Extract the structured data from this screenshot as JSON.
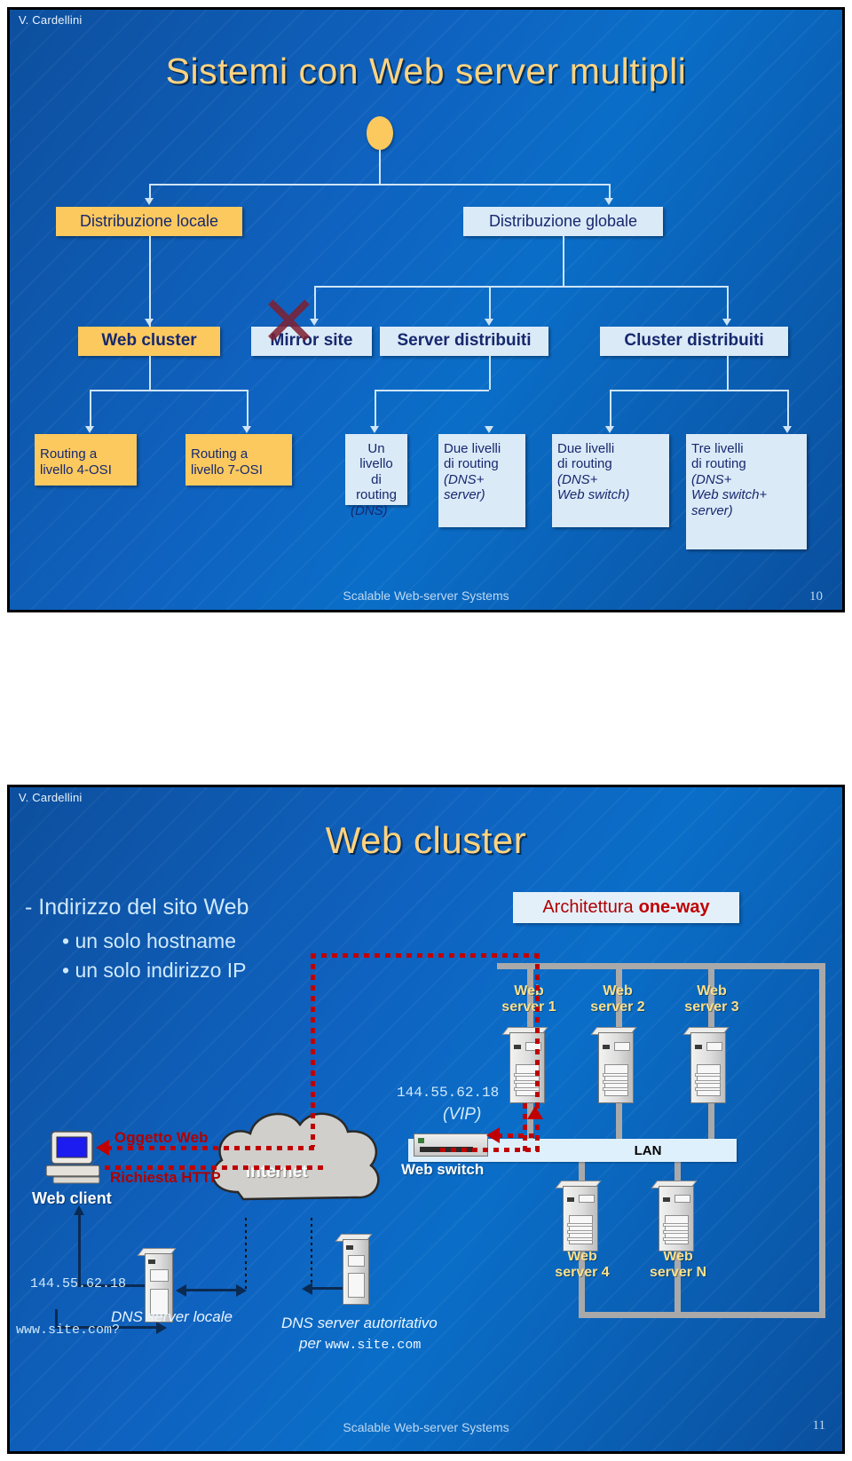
{
  "slide1": {
    "author": "V. Cardellini",
    "title": "Sistemi con Web server multipli",
    "footer": "Scalable Web-server Systems",
    "page": "10",
    "tree": {
      "level1": [
        {
          "label": "Distribuzione locale",
          "style": "gold"
        },
        {
          "label": "Distribuzione globale",
          "style": "light"
        }
      ],
      "level2": [
        {
          "label": "Web cluster",
          "style": "gold"
        },
        {
          "label": "Mirror site",
          "style": "light",
          "crossed": true
        },
        {
          "label": "Server distribuiti",
          "style": "light"
        },
        {
          "label": "Cluster distribuiti",
          "style": "light"
        }
      ],
      "level3": [
        {
          "line1": "Routing a",
          "line2": "livello 4-OSI",
          "line3": "",
          "line4": "",
          "style": "gold"
        },
        {
          "line1": "Routing a",
          "line2": "livello 7-OSI",
          "line3": "",
          "line4": "",
          "style": "gold"
        },
        {
          "line1": "Un livello",
          "line2": "di routing",
          "line3": "(DNS)",
          "line4": "",
          "style": "light"
        },
        {
          "line1": "Due livelli",
          "line2": "di routing",
          "line3": "(DNS+",
          "line4": "server)",
          "style": "light"
        },
        {
          "line1": "Due livelli",
          "line2": "di routing",
          "line3": "(DNS+",
          "line4": "Web switch)",
          "style": "light"
        },
        {
          "line1": "Tre livelli",
          "line2": "di routing",
          "line3": "(DNS+",
          "line4": "Web switch+",
          "line5": "server)",
          "style": "light"
        }
      ]
    }
  },
  "slide2": {
    "author": "V. Cardellini",
    "title": "Web cluster",
    "footer": "Scalable Web-server Systems",
    "page": "11",
    "bullets": {
      "main": "- Indirizzo del sito Web",
      "sub1": "• un solo hostname",
      "sub2": "• un solo indirizzo IP"
    },
    "architecture": {
      "prefix": "Architettura",
      "emphasis": "one-way"
    },
    "servers": [
      {
        "line1": "Web",
        "line2": "server 1"
      },
      {
        "line1": "Web",
        "line2": "server 2"
      },
      {
        "line1": "Web",
        "line2": "server 3"
      },
      {
        "line1": "Web",
        "line2": "server 4"
      },
      {
        "line1": "Web",
        "line2": "server N"
      }
    ],
    "lan_label": "LAN",
    "vip_address": "144.55.62.18",
    "vip_note": "(VIP)",
    "web_switch_label": "Web switch",
    "web_client_label": "Web client",
    "internet_label": "Internet",
    "flow_object": "Oggetto Web",
    "flow_request": "Richiesta HTTP",
    "dns_query_ip": "144.55.62.18",
    "dns_query_name": "www.site.com?",
    "dns_local_label": "DNS server locale",
    "dns_auth_label_1": "DNS server autoritativo",
    "dns_auth_label_2_pre": "per",
    "dns_auth_label_2_host": "www.site.com"
  },
  "colors": {
    "slide_bg": "#0f62bf",
    "node_gold": "#fcc95f",
    "node_light": "#dbeaf7",
    "node_text": "#16286e",
    "title_gold": "#ffd380",
    "accent_red": "#c00000"
  }
}
